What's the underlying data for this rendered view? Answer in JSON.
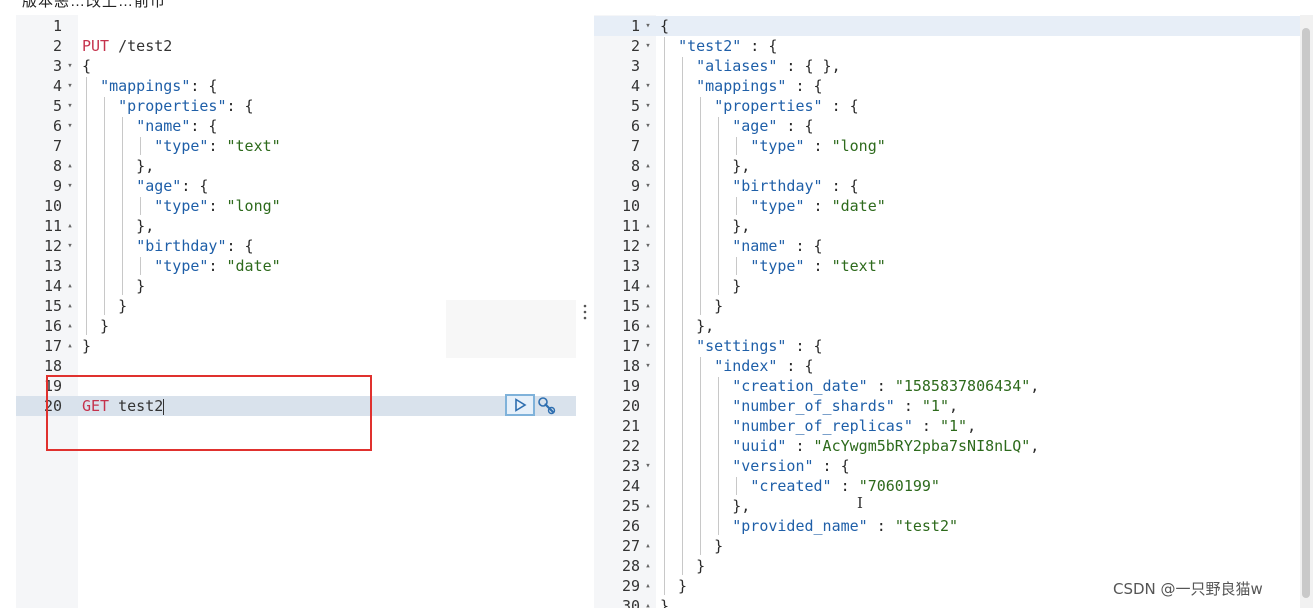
{
  "topbar": {
    "text": "版本恶…改上…前市"
  },
  "request": {
    "lines": [
      {
        "n": "1",
        "f": "",
        "t": ""
      },
      {
        "n": "2",
        "f": "",
        "t": "PUT /test2"
      },
      {
        "n": "3",
        "f": "▾",
        "t": "{"
      },
      {
        "n": "4",
        "f": "▾",
        "t": "  \"mappings\": {"
      },
      {
        "n": "5",
        "f": "▾",
        "t": "    \"properties\": {"
      },
      {
        "n": "6",
        "f": "▾",
        "t": "      \"name\": {"
      },
      {
        "n": "7",
        "f": "",
        "t": "        \"type\": \"text\""
      },
      {
        "n": "8",
        "f": "▴",
        "t": "      },"
      },
      {
        "n": "9",
        "f": "▾",
        "t": "      \"age\": {"
      },
      {
        "n": "10",
        "f": "",
        "t": "        \"type\": \"long\""
      },
      {
        "n": "11",
        "f": "▴",
        "t": "      },"
      },
      {
        "n": "12",
        "f": "▾",
        "t": "      \"birthday\": {"
      },
      {
        "n": "13",
        "f": "",
        "t": "        \"type\": \"date\""
      },
      {
        "n": "14",
        "f": "▴",
        "t": "      }"
      },
      {
        "n": "15",
        "f": "▴",
        "t": "    }"
      },
      {
        "n": "16",
        "f": "▴",
        "t": "  }"
      },
      {
        "n": "17",
        "f": "▴",
        "t": "}"
      },
      {
        "n": "18",
        "f": "",
        "t": ""
      },
      {
        "n": "19",
        "f": "",
        "t": ""
      },
      {
        "n": "20",
        "f": "",
        "t": "GET test2"
      }
    ]
  },
  "response": {
    "lines": [
      {
        "n": "1",
        "f": "▾",
        "t": "{"
      },
      {
        "n": "2",
        "f": "▾",
        "t": "  \"test2\" : {"
      },
      {
        "n": "3",
        "f": "",
        "t": "    \"aliases\" : { },"
      },
      {
        "n": "4",
        "f": "▾",
        "t": "    \"mappings\" : {"
      },
      {
        "n": "5",
        "f": "▾",
        "t": "      \"properties\" : {"
      },
      {
        "n": "6",
        "f": "▾",
        "t": "        \"age\" : {"
      },
      {
        "n": "7",
        "f": "",
        "t": "          \"type\" : \"long\""
      },
      {
        "n": "8",
        "f": "▴",
        "t": "        },"
      },
      {
        "n": "9",
        "f": "▾",
        "t": "        \"birthday\" : {"
      },
      {
        "n": "10",
        "f": "",
        "t": "          \"type\" : \"date\""
      },
      {
        "n": "11",
        "f": "▴",
        "t": "        },"
      },
      {
        "n": "12",
        "f": "▾",
        "t": "        \"name\" : {"
      },
      {
        "n": "13",
        "f": "",
        "t": "          \"type\" : \"text\""
      },
      {
        "n": "14",
        "f": "▴",
        "t": "        }"
      },
      {
        "n": "15",
        "f": "▴",
        "t": "      }"
      },
      {
        "n": "16",
        "f": "▴",
        "t": "    },"
      },
      {
        "n": "17",
        "f": "▾",
        "t": "    \"settings\" : {"
      },
      {
        "n": "18",
        "f": "▾",
        "t": "      \"index\" : {"
      },
      {
        "n": "19",
        "f": "",
        "t": "        \"creation_date\" : \"1585837806434\","
      },
      {
        "n": "20",
        "f": "",
        "t": "        \"number_of_shards\" : \"1\","
      },
      {
        "n": "21",
        "f": "",
        "t": "        \"number_of_replicas\" : \"1\","
      },
      {
        "n": "22",
        "f": "",
        "t": "        \"uuid\" : \"AcYwgm5bRY2pba7sNI8nLQ\","
      },
      {
        "n": "23",
        "f": "▾",
        "t": "        \"version\" : {"
      },
      {
        "n": "24",
        "f": "",
        "t": "          \"created\" : \"7060199\""
      },
      {
        "n": "25",
        "f": "▴",
        "t": "        },"
      },
      {
        "n": "26",
        "f": "",
        "t": "        \"provided_name\" : \"test2\""
      },
      {
        "n": "27",
        "f": "▴",
        "t": "      }"
      },
      {
        "n": "28",
        "f": "▴",
        "t": "    }"
      },
      {
        "n": "29",
        "f": "▴",
        "t": "  }"
      },
      {
        "n": "30",
        "f": "▴",
        "t": "}"
      }
    ]
  },
  "icons": {
    "run": "play-icon",
    "settings": "wrench-icon",
    "divider": "vertical-dots-icon"
  },
  "watermark": {
    "text": "CSDN @一只野良猫w"
  },
  "colors": {
    "method": "#c5324c",
    "key": "#1f5fa8",
    "string": "#2d6a1c",
    "highlight": "#e0312e"
  }
}
